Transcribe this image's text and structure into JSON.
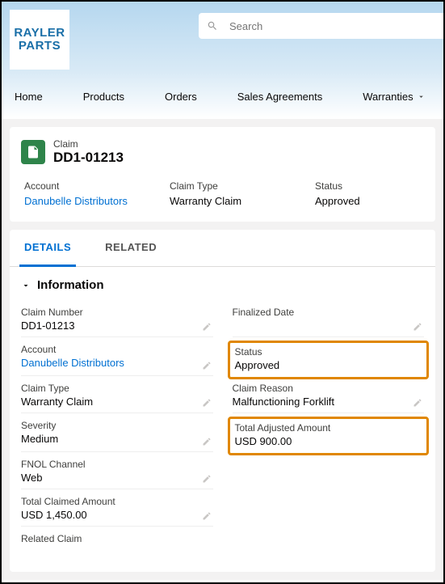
{
  "logo": "RAYLER\nPARTS",
  "search": {
    "placeholder": "Search"
  },
  "nav": {
    "home": "Home",
    "products": "Products",
    "orders": "Orders",
    "sales_agreements": "Sales Agreements",
    "warranties": "Warranties"
  },
  "record": {
    "object_label": "Claim",
    "name": "DD1-01213"
  },
  "summary": {
    "account": {
      "label": "Account",
      "value": "Danubelle Distributors"
    },
    "claim_type": {
      "label": "Claim Type",
      "value": "Warranty Claim"
    },
    "status": {
      "label": "Status",
      "value": "Approved"
    }
  },
  "tabs": {
    "details": "DETAILS",
    "related": "RELATED"
  },
  "section_title": "Information",
  "fields": {
    "claim_number": {
      "label": "Claim Number",
      "value": "DD1-01213"
    },
    "finalized_date": {
      "label": "Finalized Date",
      "value": ""
    },
    "account": {
      "label": "Account",
      "value": "Danubelle Distributors"
    },
    "status": {
      "label": "Status",
      "value": "Approved"
    },
    "claim_type": {
      "label": "Claim Type",
      "value": "Warranty Claim"
    },
    "claim_reason": {
      "label": "Claim Reason",
      "value": "Malfunctioning Forklift"
    },
    "severity": {
      "label": "Severity",
      "value": "Medium"
    },
    "total_adjusted": {
      "label": "Total Adjusted Amount",
      "value": "USD 900.00"
    },
    "fnol_channel": {
      "label": "FNOL Channel",
      "value": "Web"
    },
    "total_claimed": {
      "label": "Total Claimed Amount",
      "value": "USD 1,450.00"
    },
    "related_claim": {
      "label": "Related Claim",
      "value": ""
    }
  }
}
